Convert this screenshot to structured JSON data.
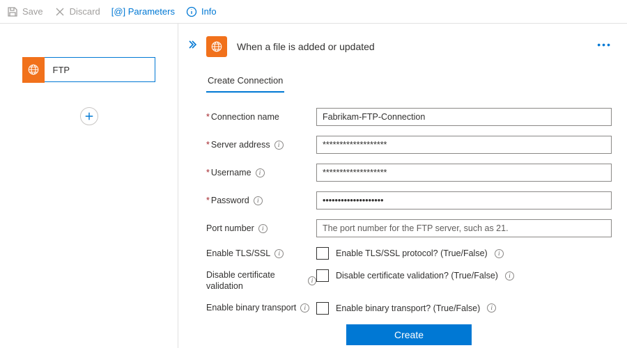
{
  "toolbar": {
    "save": "Save",
    "discard": "Discard",
    "parameters": "[@] Parameters",
    "info": "Info"
  },
  "sidebar": {
    "node_label": "FTP"
  },
  "trigger": {
    "title": "When a file is added or updated",
    "tab": "Create Connection"
  },
  "form": {
    "connection_name": {
      "label": "Connection name",
      "value": "Fabrikam-FTP-Connection"
    },
    "server_address": {
      "label": "Server address",
      "value": "*******************"
    },
    "username": {
      "label": "Username",
      "value": "*******************"
    },
    "password": {
      "label": "Password",
      "mask": "••••••••••••••••••••"
    },
    "port_number": {
      "label": "Port number",
      "placeholder": "The port number for the FTP server, such as 21."
    },
    "enable_tls": {
      "label": "Enable TLS/SSL",
      "check_label": "Enable TLS/SSL protocol? (True/False)"
    },
    "disable_cert": {
      "label": "Disable certificate validation",
      "check_label": "Disable certificate validation? (True/False)"
    },
    "enable_binary": {
      "label": "Enable binary transport",
      "check_label": "Enable binary transport? (True/False)"
    }
  },
  "buttons": {
    "create": "Create"
  }
}
